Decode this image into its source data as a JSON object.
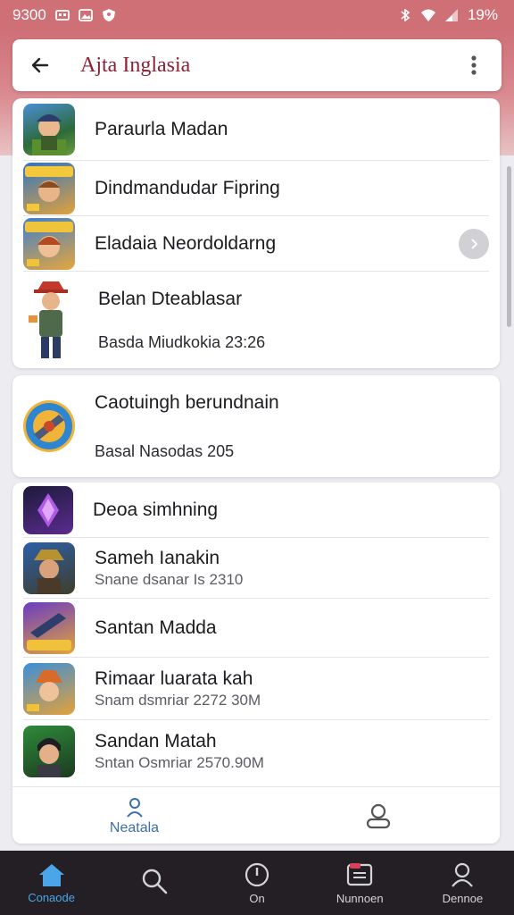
{
  "status_bar": {
    "time": "9300",
    "battery": "19%"
  },
  "app_bar": {
    "title": "Ajta Inglasia"
  },
  "list_group_1": [
    {
      "title": "Paraurla Madan",
      "subtitle": ""
    },
    {
      "title": "Dindmandudar Fipring",
      "subtitle": ""
    },
    {
      "title": "Eladaia Neordoldarng",
      "subtitle": ""
    },
    {
      "title": "Belan Dteablasar",
      "subtitle": "Basda Miudkokia 23:26"
    }
  ],
  "list_group_2": [
    {
      "title": "Caotuingh berundnain",
      "subtitle": "Basal Nasodas 205"
    }
  ],
  "list_group_3": [
    {
      "title": "Deoa simhning",
      "subtitle": ""
    },
    {
      "title": "Sameh Ianakin",
      "subtitle": "Snane dsanar Is 2310"
    },
    {
      "title": "Santan Madda",
      "subtitle": ""
    },
    {
      "title": "Rimaar luarata kah",
      "subtitle": "Snam dsmriar 2272 30M"
    },
    {
      "title": "Sandan Matah",
      "subtitle": "Sntan Osmriar 2570.90M"
    }
  ],
  "inner_tabs": [
    {
      "label": "Neatala",
      "icon": "person-pin-icon"
    },
    {
      "label": "",
      "icon": "profile-icon"
    }
  ],
  "bottom_nav": [
    {
      "label": "Conaode",
      "icon": "home-icon"
    },
    {
      "label": "",
      "icon": "search-icon"
    },
    {
      "label": "On",
      "icon": "clock-icon"
    },
    {
      "label": "Nunnoen",
      "icon": "inbox-icon"
    },
    {
      "label": "Dennoe",
      "icon": "account-icon"
    }
  ],
  "colors": {
    "header": "#cf7077",
    "title": "#8e1f34",
    "active_tab": "#4aa6e8",
    "nav_bg": "#231f24"
  }
}
